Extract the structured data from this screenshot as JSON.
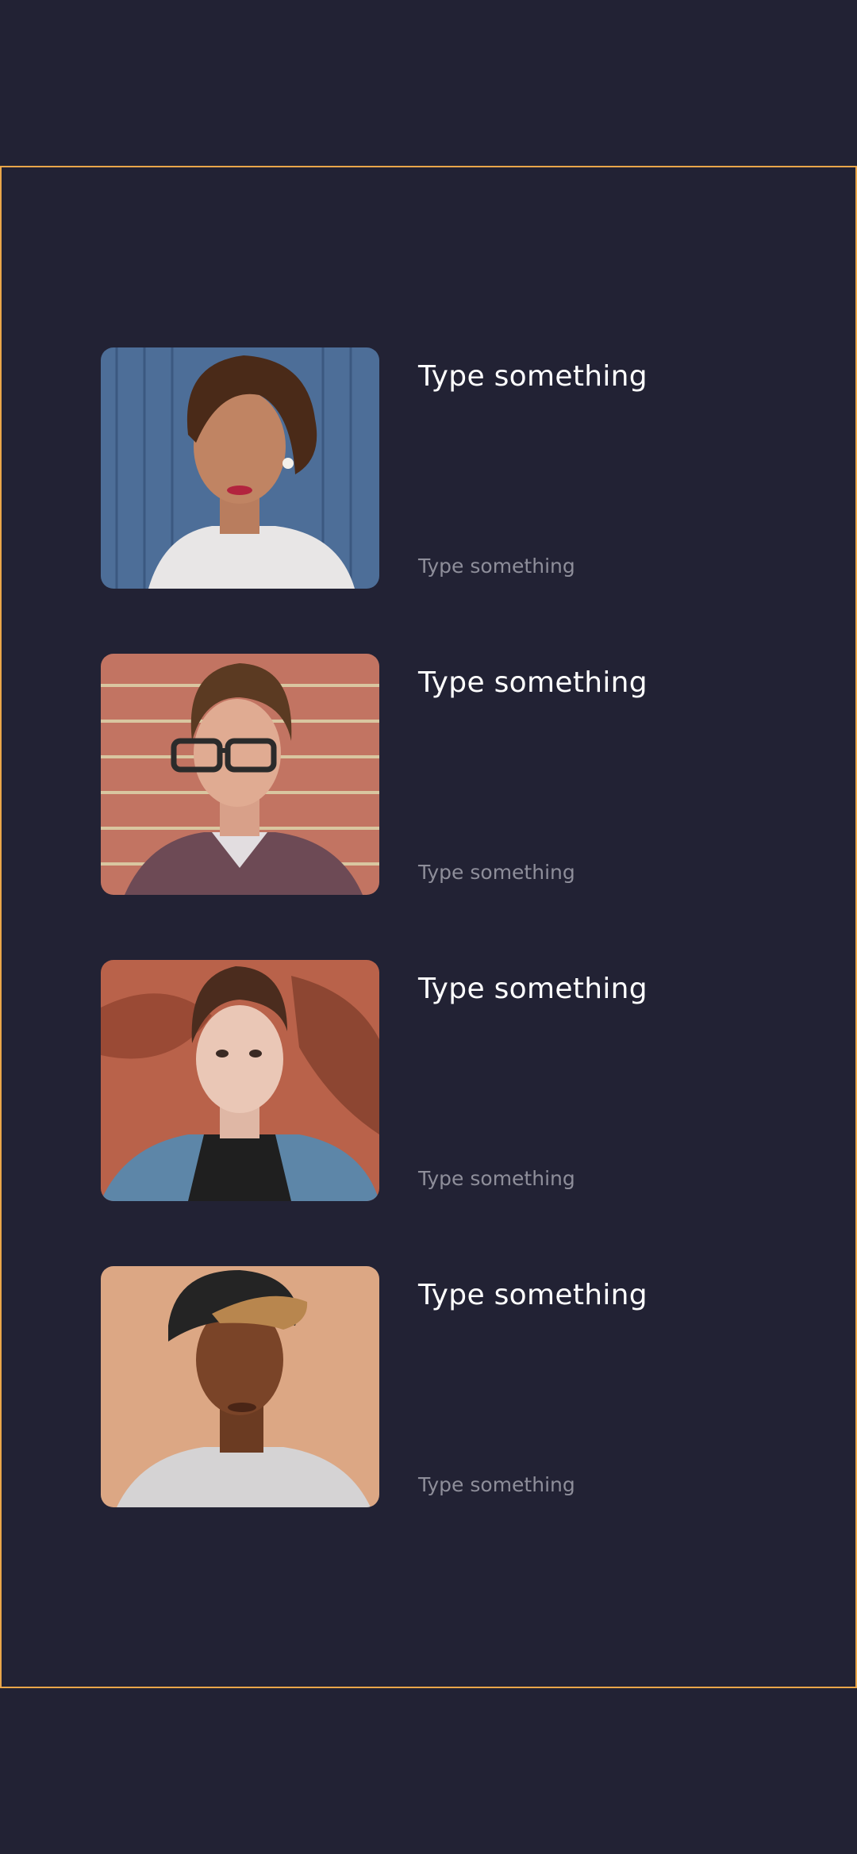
{
  "cards": [
    {
      "title": "Type something",
      "subtitle": "Type something",
      "photo": "portrait-woman-vintage-hair"
    },
    {
      "title": "Type something",
      "subtitle": "Type something",
      "photo": "portrait-man-glasses"
    },
    {
      "title": "Type something",
      "subtitle": "Type something",
      "photo": "portrait-person-denim-jacket"
    },
    {
      "title": "Type something",
      "subtitle": "Type something",
      "photo": "portrait-man-cap"
    }
  ],
  "colors": {
    "background": "#222234",
    "frame_border": "#e9a64a",
    "title": "#ffffff",
    "subtitle": "#8e8e9a"
  }
}
